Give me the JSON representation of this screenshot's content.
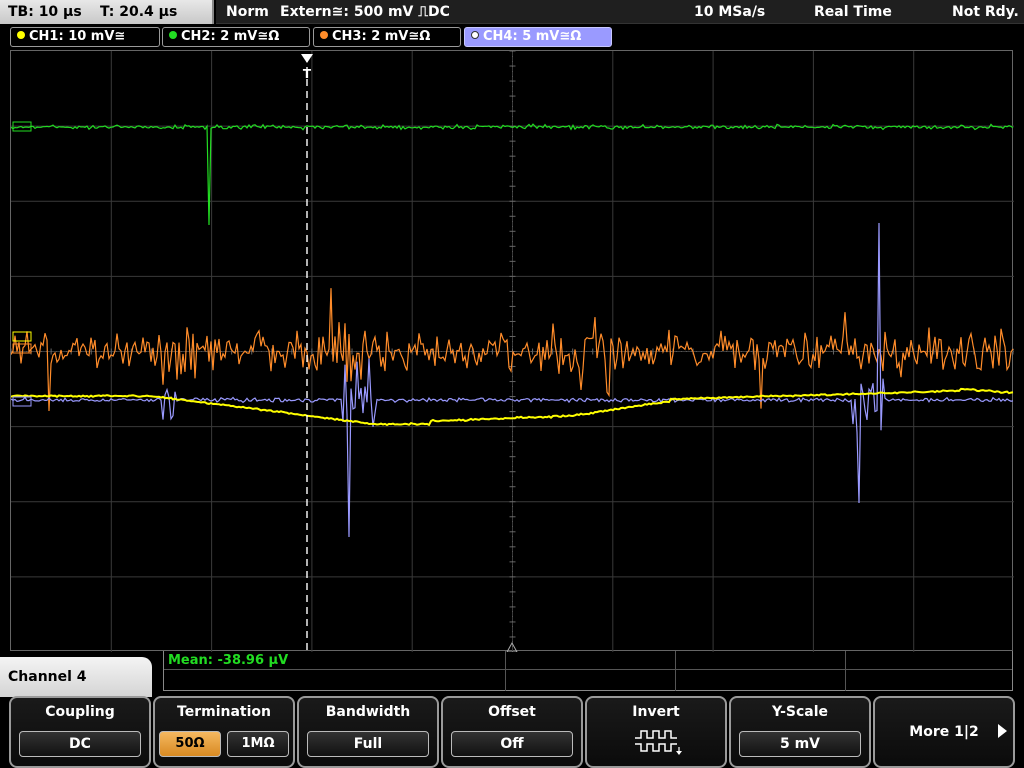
{
  "status": {
    "timebase": "TB: 10 µs",
    "trigger_time": "T: 20.4 µs",
    "mode": "Norm",
    "trigger_source": "Extern≅: 500 mV ⎍DC",
    "sample_rate": "10 MSa/s",
    "acq_mode": "Real Time",
    "trigger_state": "Not Rdy."
  },
  "channels": [
    {
      "label": "CH1: 10 mV≅",
      "color": "#ffff00"
    },
    {
      "label": "CH2: 2 mV≅Ω",
      "color": "#22dd22"
    },
    {
      "label": "CH3: 2 mV≅Ω",
      "color": "#ff8c2a"
    },
    {
      "label": "CH4: 5 mV≅Ω",
      "color": "#9a9aff"
    }
  ],
  "trigger_marker": "T",
  "measurement": {
    "mean": "Mean: -38.96 µV"
  },
  "menu": {
    "title": "Channel 4",
    "softkeys": {
      "coupling": {
        "title": "Coupling",
        "value": "DC"
      },
      "termination": {
        "title": "Termination",
        "opt1": "50Ω",
        "opt2": "1MΩ",
        "selected": "50Ω"
      },
      "bandwidth": {
        "title": "Bandwidth",
        "value": "Full"
      },
      "offset": {
        "title": "Offset",
        "value": "Off"
      },
      "invert": {
        "title": "Invert",
        "icon": "invert-pulse-icon"
      },
      "yscale": {
        "title": "Y-Scale",
        "value": "5 mV"
      },
      "more": {
        "label": "More 1|2"
      }
    }
  }
}
